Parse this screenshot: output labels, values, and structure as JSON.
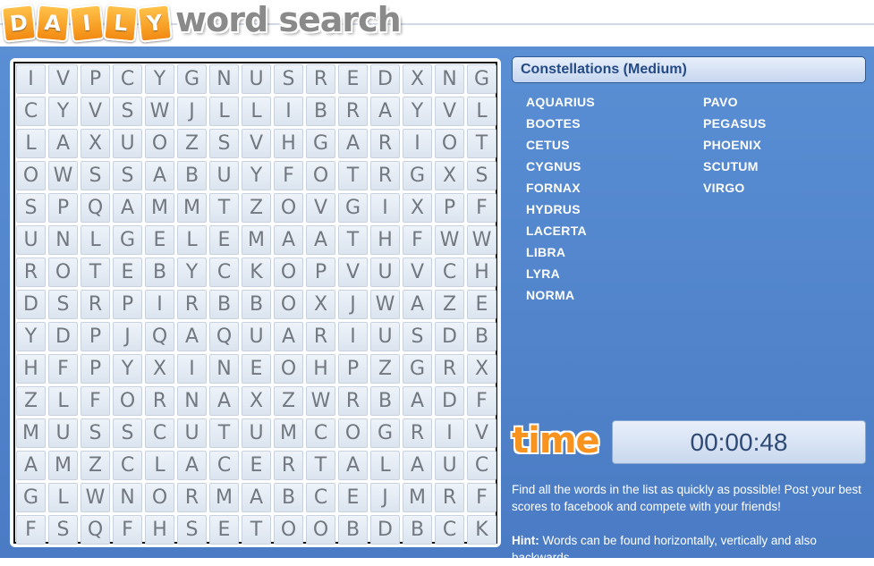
{
  "logo": {
    "tiles": [
      "D",
      "A",
      "I",
      "L",
      "Y"
    ],
    "text": "word search"
  },
  "puzzle": {
    "title": "Constellations (Medium)",
    "grid": [
      [
        "I",
        "V",
        "P",
        "C",
        "Y",
        "G",
        "N",
        "U",
        "S",
        "R",
        "E",
        "D",
        "X",
        "N",
        "G"
      ],
      [
        "C",
        "Y",
        "V",
        "S",
        "W",
        "J",
        "L",
        "L",
        "I",
        "B",
        "R",
        "A",
        "Y",
        "V",
        "L"
      ],
      [
        "L",
        "A",
        "X",
        "U",
        "O",
        "Z",
        "S",
        "V",
        "H",
        "G",
        "A",
        "R",
        "I",
        "O",
        "T"
      ],
      [
        "O",
        "W",
        "S",
        "S",
        "A",
        "B",
        "U",
        "Y",
        "F",
        "O",
        "T",
        "R",
        "G",
        "X",
        "S"
      ],
      [
        "S",
        "P",
        "Q",
        "A",
        "M",
        "M",
        "T",
        "Z",
        "O",
        "V",
        "G",
        "I",
        "X",
        "P",
        "F"
      ],
      [
        "U",
        "N",
        "L",
        "G",
        "E",
        "L",
        "E",
        "M",
        "A",
        "A",
        "T",
        "H",
        "F",
        "W",
        "W"
      ],
      [
        "R",
        "O",
        "T",
        "E",
        "B",
        "Y",
        "C",
        "K",
        "O",
        "P",
        "V",
        "U",
        "V",
        "C",
        "H"
      ],
      [
        "D",
        "S",
        "R",
        "P",
        "I",
        "R",
        "B",
        "B",
        "O",
        "X",
        "J",
        "W",
        "A",
        "Z",
        "E"
      ],
      [
        "Y",
        "D",
        "P",
        "J",
        "Q",
        "A",
        "Q",
        "U",
        "A",
        "R",
        "I",
        "U",
        "S",
        "D",
        "B"
      ],
      [
        "H",
        "F",
        "P",
        "Y",
        "X",
        "I",
        "N",
        "E",
        "O",
        "H",
        "P",
        "Z",
        "G",
        "R",
        "X"
      ],
      [
        "Z",
        "L",
        "F",
        "O",
        "R",
        "N",
        "A",
        "X",
        "Z",
        "W",
        "R",
        "B",
        "A",
        "D",
        "F"
      ],
      [
        "M",
        "U",
        "S",
        "S",
        "C",
        "U",
        "T",
        "U",
        "M",
        "C",
        "O",
        "G",
        "R",
        "I",
        "V"
      ],
      [
        "A",
        "M",
        "Z",
        "C",
        "L",
        "A",
        "C",
        "E",
        "R",
        "T",
        "A",
        "L",
        "A",
        "U",
        "C"
      ],
      [
        "G",
        "L",
        "W",
        "N",
        "O",
        "R",
        "M",
        "A",
        "B",
        "C",
        "E",
        "J",
        "M",
        "R",
        "F"
      ],
      [
        "F",
        "S",
        "Q",
        "F",
        "H",
        "S",
        "E",
        "T",
        "O",
        "O",
        "B",
        "D",
        "B",
        "C",
        "K"
      ]
    ],
    "words_col1": [
      "AQUARIUS",
      "BOOTES",
      "CETUS",
      "CYGNUS",
      "FORNAX",
      "HYDRUS",
      "LACERTA",
      "LIBRA",
      "LYRA",
      "NORMA"
    ],
    "words_col2": [
      "PAVO",
      "PEGASUS",
      "PHOENIX",
      "SCUTUM",
      "VIRGO"
    ]
  },
  "timer": {
    "label": "time",
    "value": "00:00:48"
  },
  "instructions": "Find all the words in the list as quickly as possible! Post your best scores to facebook and compete with your friends!",
  "hint": {
    "label": "Hint:",
    "text": " Words can be found horizontally, vertically and also backwards."
  },
  "colors": {
    "panel_blue": "#4a7bc4",
    "accent_orange": "#f7931e",
    "title_text": "#244a86",
    "letter_gray": "#737880"
  }
}
